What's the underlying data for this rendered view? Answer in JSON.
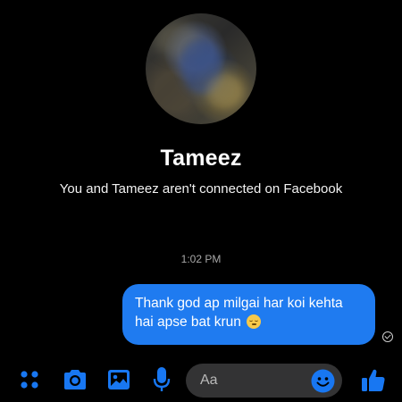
{
  "profile": {
    "name": "Tameez",
    "connection_status": "You and Tameez aren't connected on Facebook"
  },
  "conversation": {
    "timestamp": "1:02 PM",
    "messages": [
      {
        "sender": "me",
        "text": "Thank god ap milgai har koi kehta hai apse bat krun",
        "emoji": "relieved-face-emoji",
        "status": "sent"
      }
    ]
  },
  "composer": {
    "placeholder": "Aa",
    "icons": [
      "menu-dots-icon",
      "camera-icon",
      "gallery-icon",
      "microphone-icon",
      "emoji-icon",
      "thumbs-up-icon"
    ]
  },
  "colors": {
    "background": "#000000",
    "bubble": "#1f7bf0",
    "accent": "#1877f2",
    "input_background": "#333334"
  }
}
